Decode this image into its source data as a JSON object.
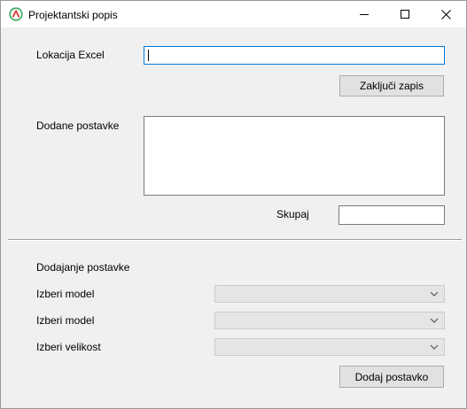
{
  "window": {
    "title": "Projektantski popis",
    "controls": {
      "minimize": "minimize",
      "maximize": "maximize",
      "close": "close"
    }
  },
  "form": {
    "excel_location_label": "Lokacija Excel",
    "excel_location_value": "",
    "finish_button": "Zaključi zapis",
    "added_items_label": "Dodane postavke",
    "added_items_value": "",
    "total_label": "Skupaj",
    "total_value": ""
  },
  "add_section": {
    "heading": "Dodajanje postavke",
    "rows": [
      {
        "label": "Izberi model",
        "selected": ""
      },
      {
        "label": "Izberi model",
        "selected": ""
      },
      {
        "label": "Izberi velikost",
        "selected": ""
      }
    ],
    "add_button": "Dodaj postavko"
  },
  "icons": {
    "app": "app-logo-icon",
    "dropdown": "chevron-down-icon"
  },
  "colors": {
    "focus_border": "#0078d7",
    "window_bg": "#f0f0f0",
    "button_bg": "#e1e1e1"
  }
}
